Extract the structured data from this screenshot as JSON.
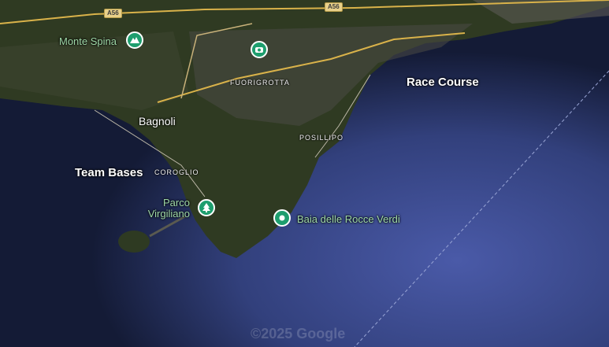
{
  "labels": {
    "race_course": "Race Course",
    "team_bases": "Team Bases",
    "bagnoli": "Bagnoli",
    "fuorigrotta": "FUORIGROTTA",
    "posillipo": "POSILLIPO",
    "coroglio": "COROGLIO"
  },
  "pois": {
    "monte_spina": "Monte Spina",
    "parco_virgiliano_line1": "Parco",
    "parco_virgiliano_line2": "Virgiliano",
    "baia": "Baia delle Rocce Verdi"
  },
  "roads": {
    "a56_left": "A56",
    "a56_right": "A56"
  },
  "icons": [
    "mountain-icon",
    "stadium-icon",
    "tree-icon",
    "place-pin-icon"
  ],
  "colors": {
    "sea": "#1e2a55",
    "land": "#2f3a22",
    "poi_green": "#1e9e6e",
    "road": "#d9b24a"
  },
  "watermark": "©2025 Google"
}
